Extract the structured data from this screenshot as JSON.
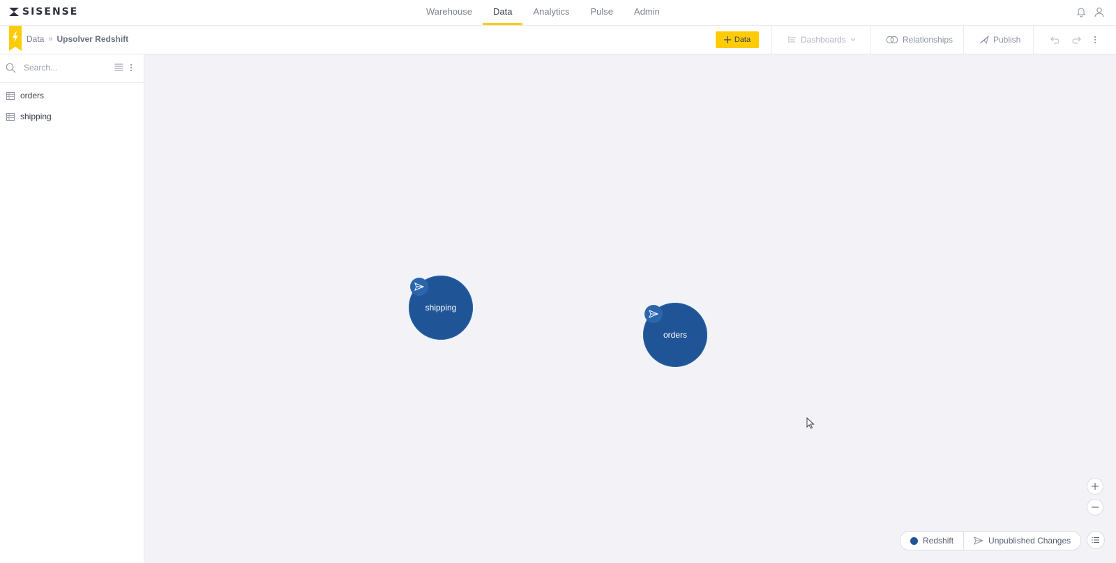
{
  "brand": {
    "logo_text": "SISENSE"
  },
  "nav": {
    "tabs": [
      {
        "label": "Warehouse"
      },
      {
        "label": "Data",
        "active": true
      },
      {
        "label": "Analytics"
      },
      {
        "label": "Pulse"
      },
      {
        "label": "Admin"
      }
    ],
    "icons": [
      "bell-icon",
      "user-icon"
    ]
  },
  "toolbar": {
    "breadcrumb": {
      "root": "Data",
      "current": "Upsolver Redshift"
    },
    "add_data_label": "Data",
    "dashboards_label": "Dashboards",
    "relationships_label": "Relationships",
    "publish_label": "Publish"
  },
  "sidebar": {
    "search_placeholder": "Search...",
    "tables": [
      {
        "label": "orders"
      },
      {
        "label": "shipping"
      }
    ]
  },
  "canvas": {
    "nodes": [
      {
        "label": "shipping"
      },
      {
        "label": "orders"
      }
    ]
  },
  "legend": {
    "source_label": "Redshift",
    "unpublished_label": "Unpublished Changes"
  },
  "colors": {
    "accent": "#ffcb05",
    "node": "#1f5596",
    "canvas_bg": "#f3f3f7"
  }
}
